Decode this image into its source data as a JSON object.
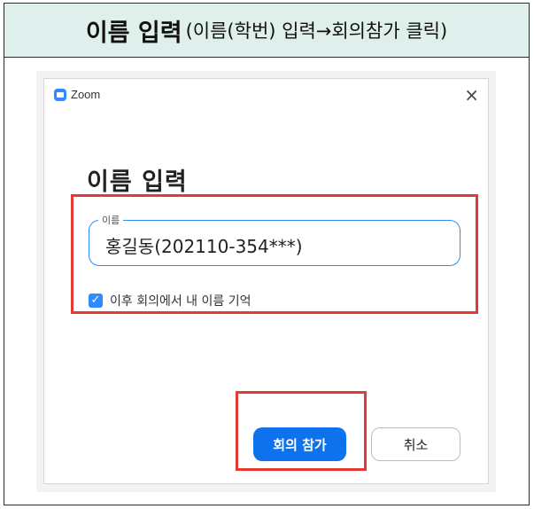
{
  "header": {
    "main": "이름 입력",
    "sub": "(이름(학번) 입력→회의참가 클릭)"
  },
  "dialog": {
    "title": "Zoom",
    "close_icon": "×",
    "heading": "이름 입력",
    "name_field": {
      "label": "이름",
      "value": "홍길동(202110-354***)"
    },
    "remember": {
      "checked": true,
      "check_glyph": "✓",
      "label": "이후 회의에서 내 이름 기억"
    },
    "buttons": {
      "join": "회의 참가",
      "cancel": "취소"
    }
  },
  "colors": {
    "header_bg": "#dff0ec",
    "accent": "#0e72ed",
    "field_border": "#2d8cff",
    "highlight": "#e53935"
  }
}
